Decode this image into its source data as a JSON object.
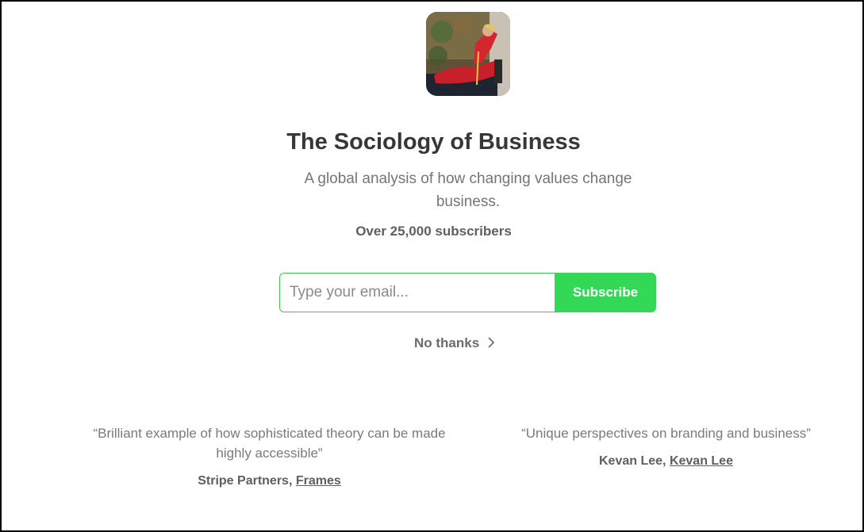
{
  "publication": {
    "logo_icon": "publication-logo",
    "title": "The Sociology of Business",
    "subtitle": "A global analysis of how changing values change business.",
    "subscriber_count": "Over 25,000 subscribers"
  },
  "signup": {
    "email_placeholder": "Type your email...",
    "subscribe_label": "Subscribe",
    "no_thanks_label": "No thanks",
    "no_thanks_icon": "chevron-right-icon",
    "accent_color": "#34d857"
  },
  "testimonials": [
    {
      "quote": "“Brilliant example of how sophisticated theory can be made highly accessible”",
      "author": "Stripe Partners, ",
      "source": "Frames"
    },
    {
      "quote": "“Unique perspectives on branding and business”",
      "author": "Kevan Lee, ",
      "source": "Kevan Lee"
    }
  ]
}
